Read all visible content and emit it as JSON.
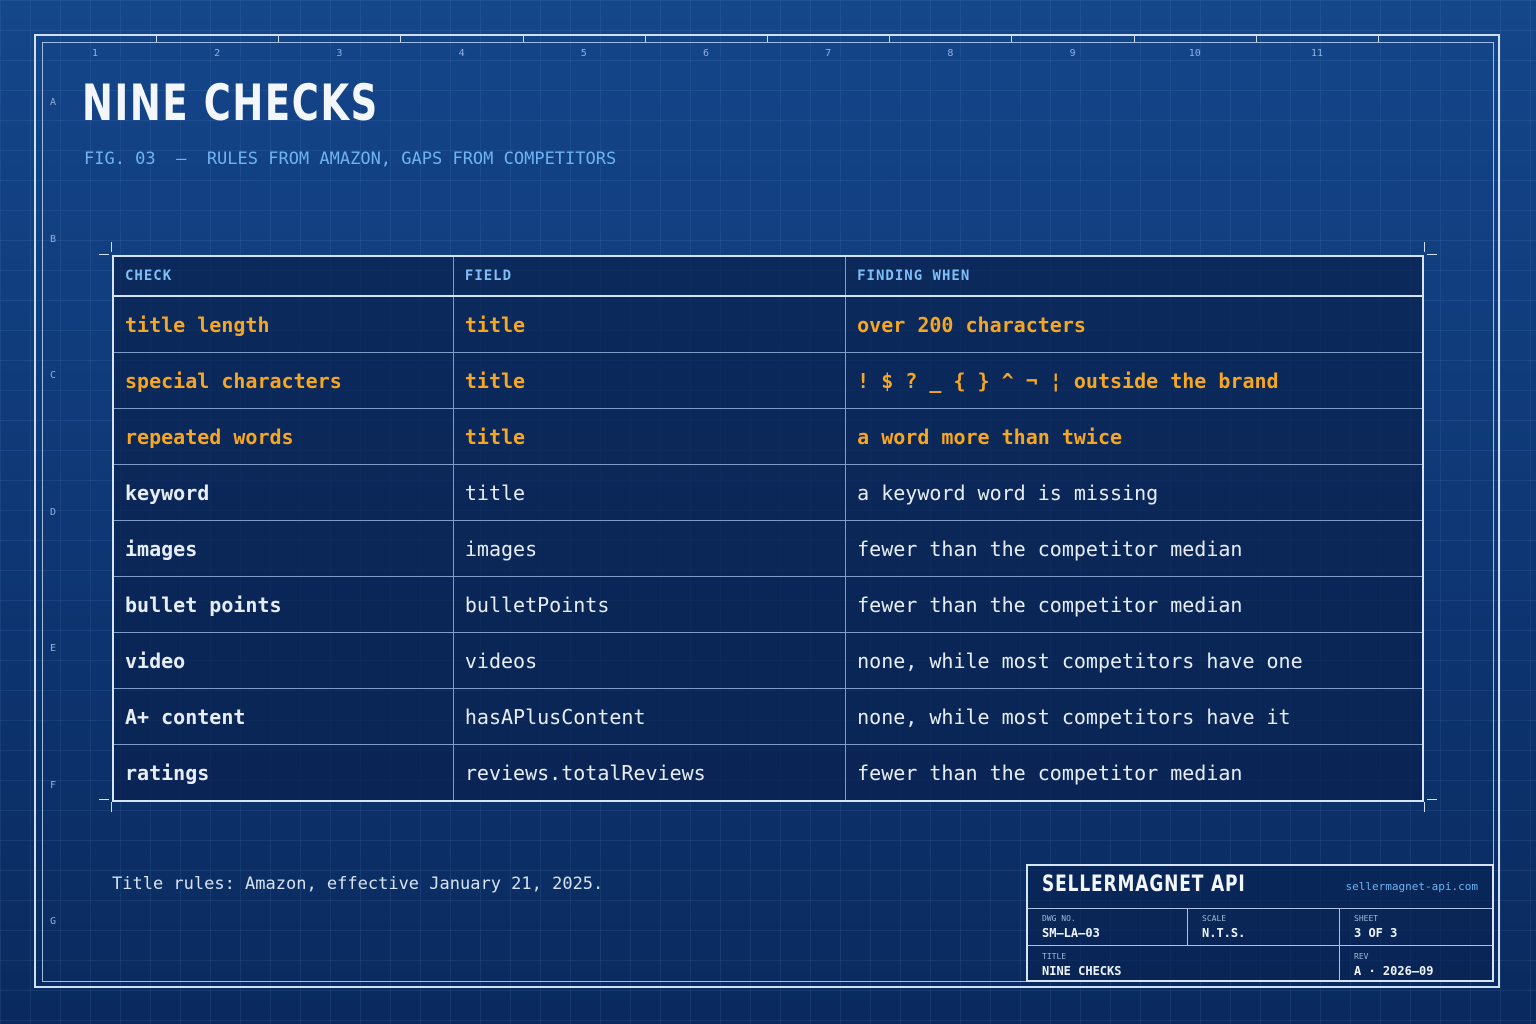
{
  "header": {
    "title": "NINE CHECKS",
    "subtitle": "FIG. 03  —  RULES FROM AMAZON, GAPS FROM COMPETITORS"
  },
  "grid_columns": [
    "1",
    "2",
    "3",
    "4",
    "5",
    "6",
    "7",
    "8",
    "9",
    "10",
    "11"
  ],
  "grid_rows": [
    "A",
    "B",
    "C",
    "D",
    "E",
    "F",
    "G"
  ],
  "table": {
    "headers": [
      "CHECK",
      "FIELD",
      "FINDING WHEN"
    ],
    "rows": [
      {
        "check": "title length",
        "field": "title",
        "finding": "over 200 characters",
        "emphasis": true
      },
      {
        "check": "special characters",
        "field": "title",
        "finding": "! $ ? _ { } ^ ¬ ¦ outside the brand",
        "emphasis": true
      },
      {
        "check": "repeated words",
        "field": "title",
        "finding": "a word more than twice",
        "emphasis": true
      },
      {
        "check": "keyword",
        "field": "title",
        "finding": "a keyword word is missing",
        "emphasis": false
      },
      {
        "check": "images",
        "field": "images",
        "finding": "fewer than the competitor median",
        "emphasis": false
      },
      {
        "check": "bullet points",
        "field": "bulletPoints",
        "finding": "fewer than the competitor median",
        "emphasis": false
      },
      {
        "check": "video",
        "field": "videos",
        "finding": "none, while most competitors have one",
        "emphasis": false
      },
      {
        "check": "A+ content",
        "field": "hasAPlusContent",
        "finding": "none, while most competitors have it",
        "emphasis": false
      },
      {
        "check": "ratings",
        "field": "reviews.totalReviews",
        "finding": "fewer than the competitor median",
        "emphasis": false
      }
    ]
  },
  "footnote": "Title rules: Amazon, effective January 21, 2025.",
  "title_block": {
    "brand": "SELLERMAGNET API",
    "url": "sellermagnet-api.com",
    "dwg_label": "DWG NO.",
    "dwg_value": "SM–LA–03",
    "scale_label": "SCALE",
    "scale_value": "N.T.S.",
    "sheet_label": "SHEET",
    "sheet_value": "3 OF 3",
    "title_label": "TITLE",
    "title_value": "NINE CHECKS",
    "rev_label": "REV",
    "rev_value": "A · 2026–09"
  },
  "colors": {
    "background": "#0f3a76",
    "accent_orange": "#f5a623",
    "accent_blue": "#6fb3f2",
    "frame": "#cfe0f5"
  }
}
